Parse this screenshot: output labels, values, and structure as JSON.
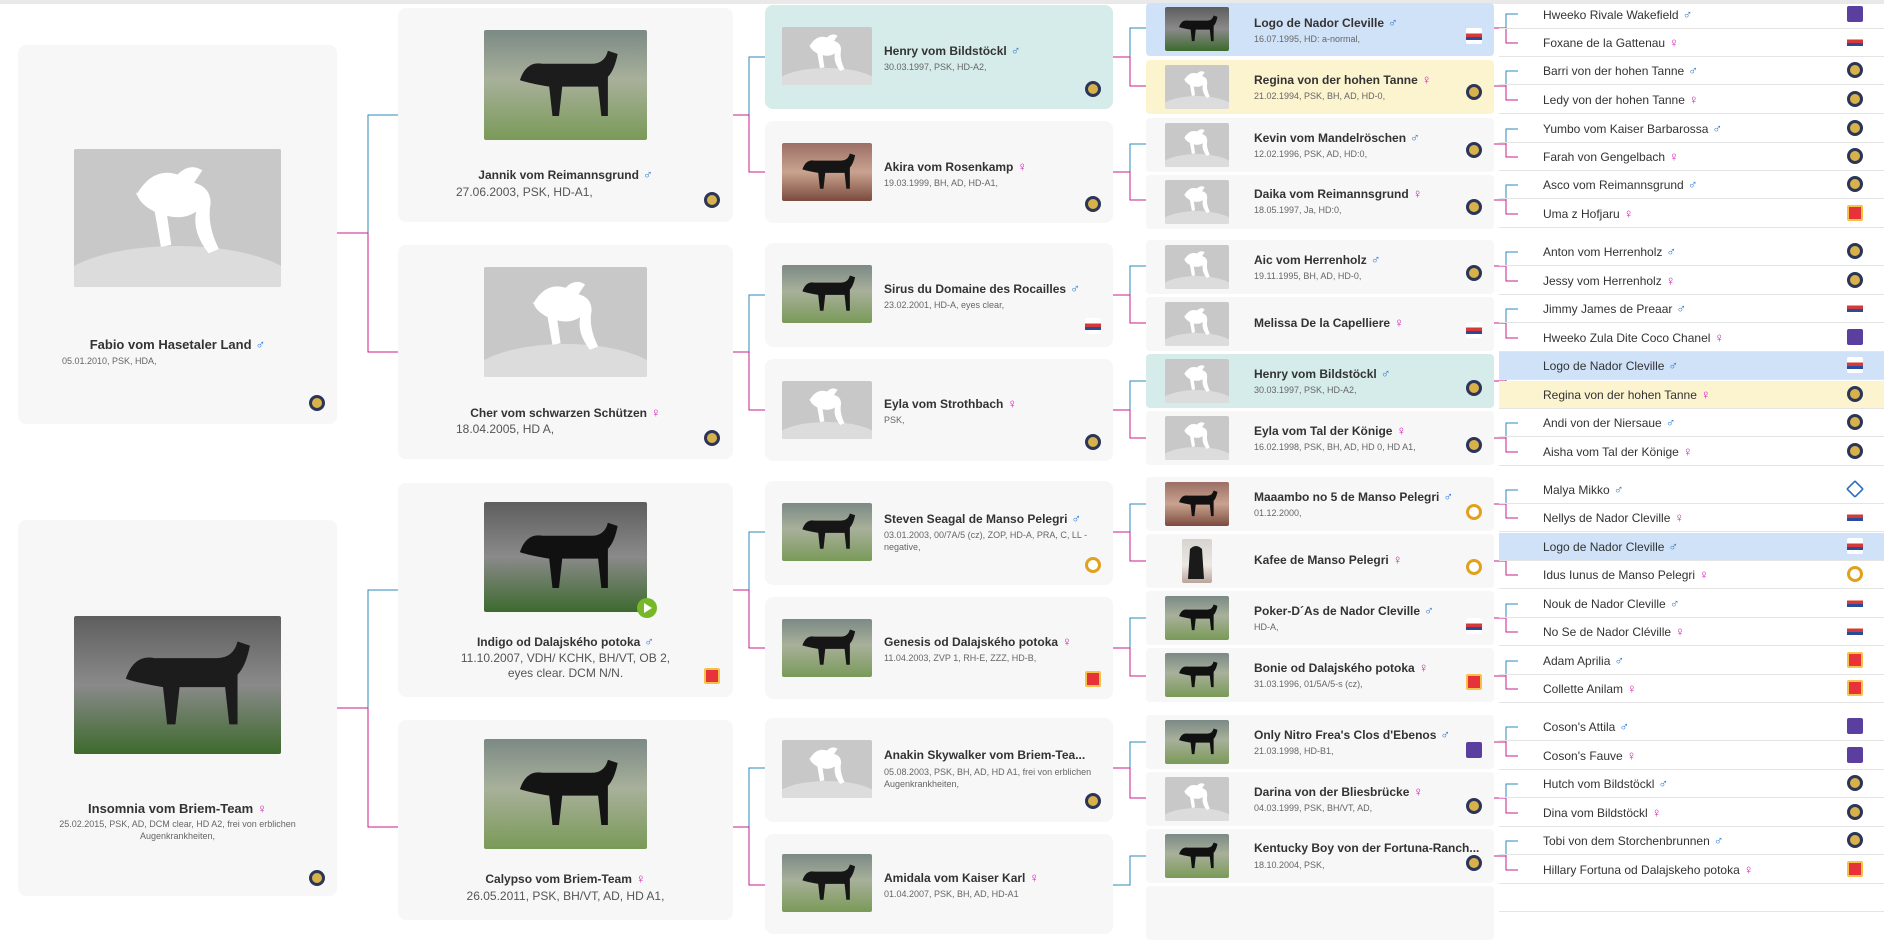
{
  "gen1": [
    {
      "name": "Fabio vom Hasetaler Land",
      "sex": "♂",
      "info": "05.01.2010, PSK, HDA,"
    },
    {
      "name": "Insomnia vom Briem-Team",
      "sex": "♀",
      "info": "25.02.2015, PSK, AD, DCM clear, HD A2, frei von erblichen Augenkrankheiten,"
    }
  ],
  "gen2": [
    {
      "name": "Jannik vom Reimannsgrund",
      "sex": "♂",
      "info": "27.06.2003, PSK, HD-A1,"
    },
    {
      "name": "Cher vom schwarzen Schützen",
      "sex": "♀",
      "info": "18.04.2005, HD A,"
    },
    {
      "name": "Indigo od Dalajského potoka",
      "sex": "♂",
      "info": "11.10.2007, VDH/ KCHK, BH/VT, OB 2, eyes clear. DCM N/N."
    },
    {
      "name": "Calypso vom Briem-Team",
      "sex": "♀",
      "info": "26.05.2011, PSK, BH/VT, AD, HD A1,"
    }
  ],
  "gen3": [
    {
      "name": "Henry vom Bildstöckl",
      "sex": "♂",
      "info": "30.03.1997, PSK, HD-A2,"
    },
    {
      "name": "Akira vom Rosenkamp",
      "sex": "♀",
      "info": "19.03.1999, BH, AD, HD-A1,"
    },
    {
      "name": "Sirus du Domaine des Rocailles",
      "sex": "♂",
      "info": "23.02.2001, HD-A, eyes clear,"
    },
    {
      "name": "Eyla vom Strothbach",
      "sex": "♀",
      "info": "PSK,"
    },
    {
      "name": "Steven Seagal de Manso Pelegri",
      "sex": "♂",
      "info": "03.01.2003, 00/7A/5 (cz), ZOP, HD-A, PRA, C, LL - negative,"
    },
    {
      "name": "Genesis od Dalajského potoka",
      "sex": "♀",
      "info": "11.04.2003, ZVP 1, RH-E, ZZZ, HD-B,"
    },
    {
      "name": "Anakin Skywalker vom Briem-Tea...",
      "sex": "",
      "info": "05.08.2003, PSK, BH, AD, HD A1, frei von erblichen Augenkrankheiten,"
    },
    {
      "name": "Amidala vom Kaiser Karl",
      "sex": "♀",
      "info": "01.04.2007, PSK, BH, AD, HD-A1"
    }
  ],
  "gen4": [
    {
      "name": "Logo de Nador Cleville",
      "sex": "♂",
      "info": "16.07.1995, HD: a-normal,"
    },
    {
      "name": "Regina von der hohen Tanne",
      "sex": "♀",
      "info": "21.02.1994, PSK, BH, AD, HD-0,"
    },
    {
      "name": "Kevin vom Mandelröschen",
      "sex": "♂",
      "info": "12.02.1996, PSK, AD, HD:0,"
    },
    {
      "name": "Daika vom Reimannsgrund",
      "sex": "♀",
      "info": "18.05.1997, Ja, HD:0,"
    },
    {
      "name": "Aic vom Herrenholz",
      "sex": "♂",
      "info": "19.11.1995, BH, AD, HD-0,"
    },
    {
      "name": "Melissa De la Capelliere",
      "sex": "♀",
      "info": ""
    },
    {
      "name": "Henry vom Bildstöckl",
      "sex": "♂",
      "info": "30.03.1997, PSK, HD-A2,"
    },
    {
      "name": "Eyla vom Tal der Könige",
      "sex": "♀",
      "info": "16.02.1998, PSK, BH, AD, HD 0, HD A1,"
    },
    {
      "name": "Maaambo no 5 de Manso Pelegri",
      "sex": "♂",
      "info": "01.12.2000,"
    },
    {
      "name": "Kafee de Manso Pelegri",
      "sex": "♀",
      "info": ""
    },
    {
      "name": "Poker-D´As de Nador Cleville",
      "sex": "♂",
      "info": "HD-A,"
    },
    {
      "name": "Bonie od Dalajského potoka",
      "sex": "♀",
      "info": "31.03.1996, 01/5A/5-s (cz),"
    },
    {
      "name": "Only Nitro Frea's Clos d'Ebenos",
      "sex": "♂",
      "info": "21.03.1998, HD-B1,"
    },
    {
      "name": "Darina von der Bliesbrücke",
      "sex": "♀",
      "info": "04.03.1999, PSK, BH/VT, AD,"
    },
    {
      "name": "Kentucky Boy von der Fortuna-Ranch...",
      "sex": "",
      "info": "18.10.2004, PSK,"
    },
    {
      "name": "",
      "sex": "",
      "info": ""
    }
  ],
  "gen5": [
    {
      "name": "Hweeko Rivale Wakefield",
      "sex": "♂"
    },
    {
      "name": "Foxane de la Gattenau",
      "sex": "♀"
    },
    {
      "name": "Barri von der hohen Tanne",
      "sex": "♂"
    },
    {
      "name": "Ledy von der hohen Tanne",
      "sex": "♀"
    },
    {
      "name": "Yumbo vom Kaiser Barbarossa",
      "sex": "♂"
    },
    {
      "name": "Farah von Gengelbach",
      "sex": "♀"
    },
    {
      "name": "Asco vom Reimannsgrund",
      "sex": "♂"
    },
    {
      "name": "Uma z Hofjaru",
      "sex": "♀"
    },
    {
      "name": "Anton vom Herrenholz",
      "sex": "♂"
    },
    {
      "name": "Jessy vom Herrenholz",
      "sex": "♀"
    },
    {
      "name": "Jimmy James de Preaar",
      "sex": "♂"
    },
    {
      "name": "Hweeko Zula Dite Coco Chanel",
      "sex": "♀"
    },
    {
      "name": "Logo de Nador Cleville",
      "sex": "♂"
    },
    {
      "name": "Regina von der hohen Tanne",
      "sex": "♀"
    },
    {
      "name": "Andi von der Niersaue",
      "sex": "♂"
    },
    {
      "name": "Aisha vom Tal der Könige",
      "sex": "♀"
    },
    {
      "name": "Malya Mikko",
      "sex": "♂"
    },
    {
      "name": "Nellys de Nador Cleville",
      "sex": "♀"
    },
    {
      "name": "Logo de Nador Cleville",
      "sex": "♂"
    },
    {
      "name": "Idus Iunus de Manso Pelegri",
      "sex": "♀"
    },
    {
      "name": "Nouk de Nador Cleville",
      "sex": "♂"
    },
    {
      "name": "No Se de Nador Cléville",
      "sex": "♀"
    },
    {
      "name": "Adam Aprilia",
      "sex": "♂"
    },
    {
      "name": "Collette Anilam",
      "sex": "♀"
    },
    {
      "name": "Coson's Attila",
      "sex": "♂"
    },
    {
      "name": "Coson's Fauve",
      "sex": "♀"
    },
    {
      "name": "Hutch vom Bildstöckl",
      "sex": "♂"
    },
    {
      "name": "Dina vom Bildstöckl",
      "sex": "♀"
    },
    {
      "name": "Tobi von dem Storchenbrunnen",
      "sex": "♂"
    },
    {
      "name": "Hillary Fortuna od Dalajskeho potoka",
      "sex": "♀"
    },
    {
      "name": "",
      "sex": ""
    }
  ],
  "colors": {
    "highlight_blue": "#cfe2f7",
    "highlight_yellow": "#fcf3cf",
    "highlight_teal": "#d5ecea",
    "male": "#2e78c8",
    "female": "#d21fb8",
    "line_male": "#2e88b8",
    "line_female": "#c81e8e"
  },
  "icons": {
    "placeholder": "dog-silhouette-icon",
    "video": "play-icon",
    "registry": "club-badge-icon"
  }
}
